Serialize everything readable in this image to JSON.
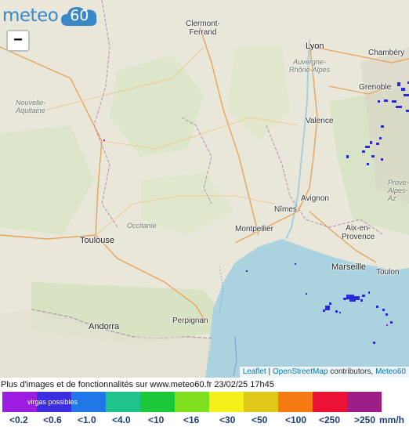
{
  "brand": {
    "word": "meteo",
    "number": "60",
    "color": "#3a88c8"
  },
  "zoom": {
    "out_label": "−"
  },
  "cities": {
    "clermont": "Clermont-\nFerrand",
    "lyon": "Lyon",
    "chambery": "Chambéry",
    "grenoble": "Grenoble",
    "valence": "Valence",
    "nimes": "Nîmes",
    "avignon": "Avignon",
    "montpellier": "Montpellier",
    "aix": "Aix-en-\nProvence",
    "marseille": "Marseille",
    "toulon": "Toulon",
    "toulouse": "Toulouse",
    "andorra": "Andorra",
    "perpignan": "Perpignan"
  },
  "regions": {
    "nouvelle_aquitaine": "Nouvelle-\nAquitaine",
    "occitanie": "Occitanie",
    "auvergne": "Auvergne-\nRhône-Alpes",
    "provence": "Prove-\nAlpes-\nAz"
  },
  "attribution": {
    "leaflet": "Leaflet",
    "sep": " | ",
    "osm": "OpenStreetMap",
    "contributors": " contributors, ",
    "meteo60": "Meteo60"
  },
  "footer": {
    "text": "Plus d'images et de fonctionnalités sur www.meteo60.fr 23/02/25 17h45"
  },
  "legend": {
    "virgas_label": "virgas possibles",
    "unit": "mm/h",
    "items": [
      {
        "label": "<0.2",
        "color": "#9a1de0"
      },
      {
        "label": "<0.6",
        "color": "#3a2ee0"
      },
      {
        "label": "<1.0",
        "color": "#2277e8"
      },
      {
        "label": "<4.0",
        "color": "#1fc48c"
      },
      {
        "label": "<10",
        "color": "#1bc83a"
      },
      {
        "label": "<16",
        "color": "#7ee01e"
      },
      {
        "label": "<30",
        "color": "#f5f01a"
      },
      {
        "label": "<50",
        "color": "#e0c81a"
      },
      {
        "label": "<100",
        "color": "#f57a12"
      },
      {
        "label": "<250",
        "color": "#eb1236"
      },
      {
        "label": ">250",
        "color": "#9c1e86"
      }
    ]
  },
  "colors": {
    "sea": "#aad3df",
    "land": "#e9e7da",
    "forest": "#cfe3b8",
    "radar": "#2a2ad8"
  }
}
